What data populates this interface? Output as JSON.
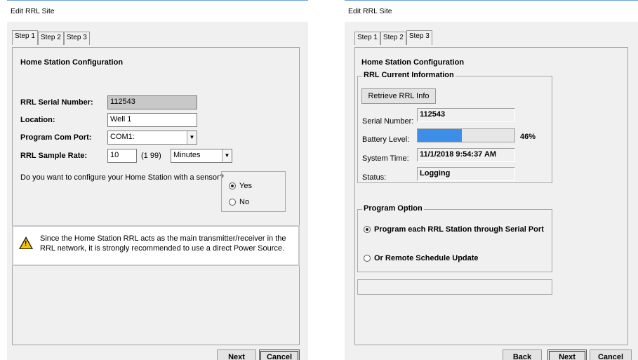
{
  "left": {
    "title": "Edit RRL Site",
    "tabs": [
      "Step 1",
      "Step 2",
      "Step 3"
    ],
    "active_tab": "Step 1",
    "heading": "Home Station Configuration",
    "serial_label": "RRL Serial Number:",
    "serial_value": "112543",
    "location_label": "Location:",
    "location_value": "Well 1",
    "comport_label": "Program Com Port:",
    "comport_value": "COM1:",
    "rate_label": "RRL Sample Rate:",
    "rate_value": "10",
    "rate_range": "(1  99)",
    "rate_unit": "Minutes",
    "sensor_question": "Do you want to configure your Home Station with a sensor?",
    "yes_label": "Yes",
    "no_label": "No",
    "sensor_selected": "Yes",
    "warning_text": "Since the Home Station RRL acts as the main transmitter/receiver in the RRL network, it is strongly recommended to use a direct Power Source.",
    "next_label": "Next",
    "cancel_label": "Cancel"
  },
  "right": {
    "title": "Edit RRL Site",
    "tabs": [
      "Step 1",
      "Step 2",
      "Step 3"
    ],
    "active_tab": "Step 3",
    "heading": "Home Station Configuration",
    "info_group": "RRL Current Information",
    "retrieve_label": "Retrieve RRL Info",
    "serial_label": "Serial Number:",
    "serial_value": "112543",
    "battery_label": "Battery Level:",
    "battery_percent": 46,
    "battery_text": "46%",
    "time_label": "System Time:",
    "time_value": "11/1/2018 9:54:37 AM",
    "status_label": "Status:",
    "status_value": "Logging",
    "program_group": "Program Option",
    "option1": "Program each RRL Station through Serial Port",
    "option2": "Or Remote Schedule Update",
    "back_label": "Back",
    "next_label": "Next",
    "cancel_label": "Cancel"
  },
  "colors": {
    "progress_fill": "#3c8ee6",
    "window_bg": "#f0f0f0",
    "title_border": "#6ea0d8"
  }
}
